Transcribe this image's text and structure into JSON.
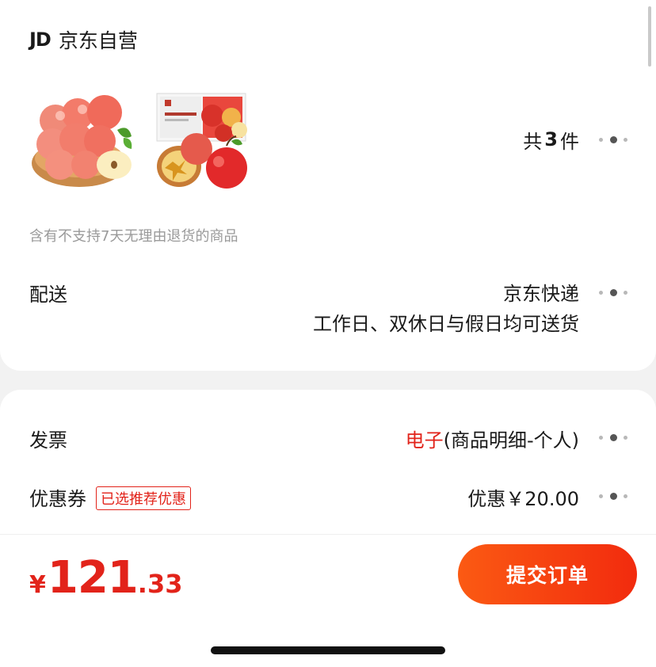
{
  "shop": {
    "logo_text": "JD",
    "name": "京东自营"
  },
  "products": {
    "thumbs": [
      {
        "icon": "apple-bowl-image"
      },
      {
        "icon": "apple-gift-box-image"
      }
    ],
    "count_prefix": "共",
    "count": "3",
    "count_suffix": "件",
    "return_notice": "含有不支持7天无理由退货的商品"
  },
  "delivery": {
    "label": "配送",
    "carrier": "京东快递",
    "schedule": "工作日、双休日与假日均可送货"
  },
  "invoice": {
    "label": "发票",
    "type": "电子",
    "detail": "(商品明细-个人)"
  },
  "coupon": {
    "label": "优惠券",
    "tag": "已选推荐优惠",
    "value": "优惠￥20.00"
  },
  "footer": {
    "currency": "¥",
    "price_int": "121",
    "price_dec": ".33",
    "submit_label": "提交订单"
  },
  "colors": {
    "accent_red": "#e2231a",
    "button_gradient_start": "#fb5a13",
    "button_gradient_end": "#f22b0e"
  }
}
